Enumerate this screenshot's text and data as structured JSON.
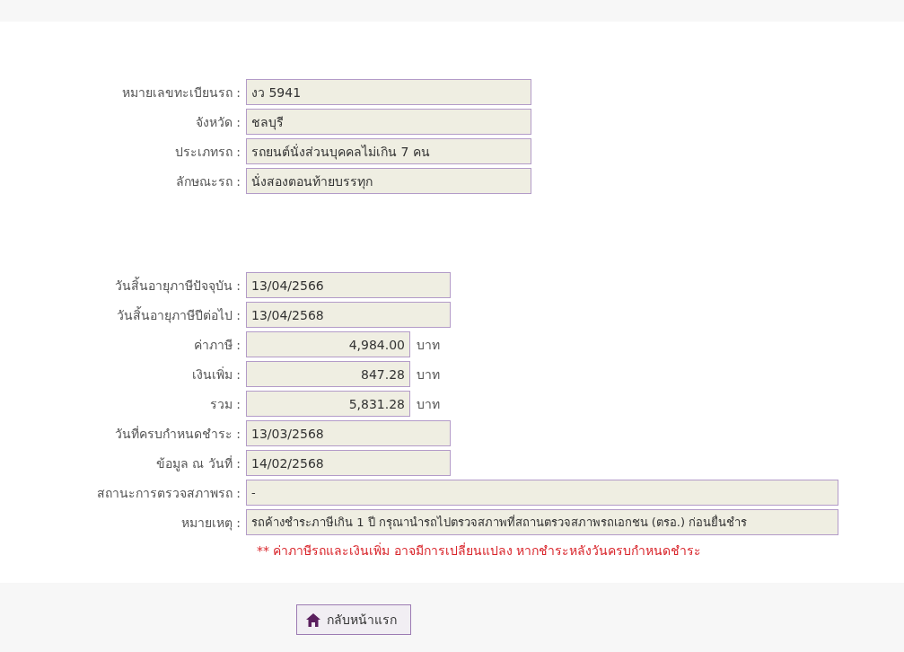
{
  "vehicle": [
    {
      "label": "หมายเลขทะเบียนรถ :",
      "value": "งว 5941",
      "kind": "text"
    },
    {
      "label": "จังหวัด :",
      "value": "ชลบุรี",
      "kind": "text"
    },
    {
      "label": "ประเภทรถ :",
      "value": "รถยนต์นั่งส่วนบุคคลไม่เกิน 7 คน",
      "kind": "text"
    },
    {
      "label": "ลักษณะรถ :",
      "value": "นั่งสองตอนท้ายบรรทุก",
      "kind": "text"
    }
  ],
  "tax": [
    {
      "label": "วันสิ้นอายุภาษีปัจจุบัน :",
      "value": "13/04/2566",
      "kind": "date"
    },
    {
      "label": "วันสิ้นอายุภาษีปีต่อไป :",
      "value": "13/04/2568",
      "kind": "date"
    },
    {
      "label": "ค่าภาษี :",
      "value": "4,984.00",
      "kind": "money",
      "unit": "บาท"
    },
    {
      "label": "เงินเพิ่ม :",
      "value": "847.28",
      "kind": "money",
      "unit": "บาท"
    },
    {
      "label": "รวม :",
      "value": "5,831.28",
      "kind": "money",
      "unit": "บาท"
    },
    {
      "label": "วันที่ครบกำหนดชำระ :",
      "value": "13/03/2568",
      "kind": "date"
    },
    {
      "label": "ข้อมูล ณ วันที่ :",
      "value": "14/02/2568",
      "kind": "date"
    },
    {
      "label": "สถานะการตรวจสภาพรถ :",
      "value": "-",
      "kind": "wide"
    },
    {
      "label": "หมายเหตุ :",
      "value": "รถค้างชำระภาษีเกิน 1 ปี กรุณานำรถไปตรวจสภาพที่สถานตรวจสภาพรถเอกชน (ตรอ.) ก่อนยื่นชำร",
      "kind": "wide"
    }
  ],
  "note": "** ค่าภาษีรถและเงินเพิ่ม อาจมีการเปลี่ยนแปลง หากชำระหลังวันครบกำหนดชำระ",
  "home_button": "กลับหน้าแรก"
}
